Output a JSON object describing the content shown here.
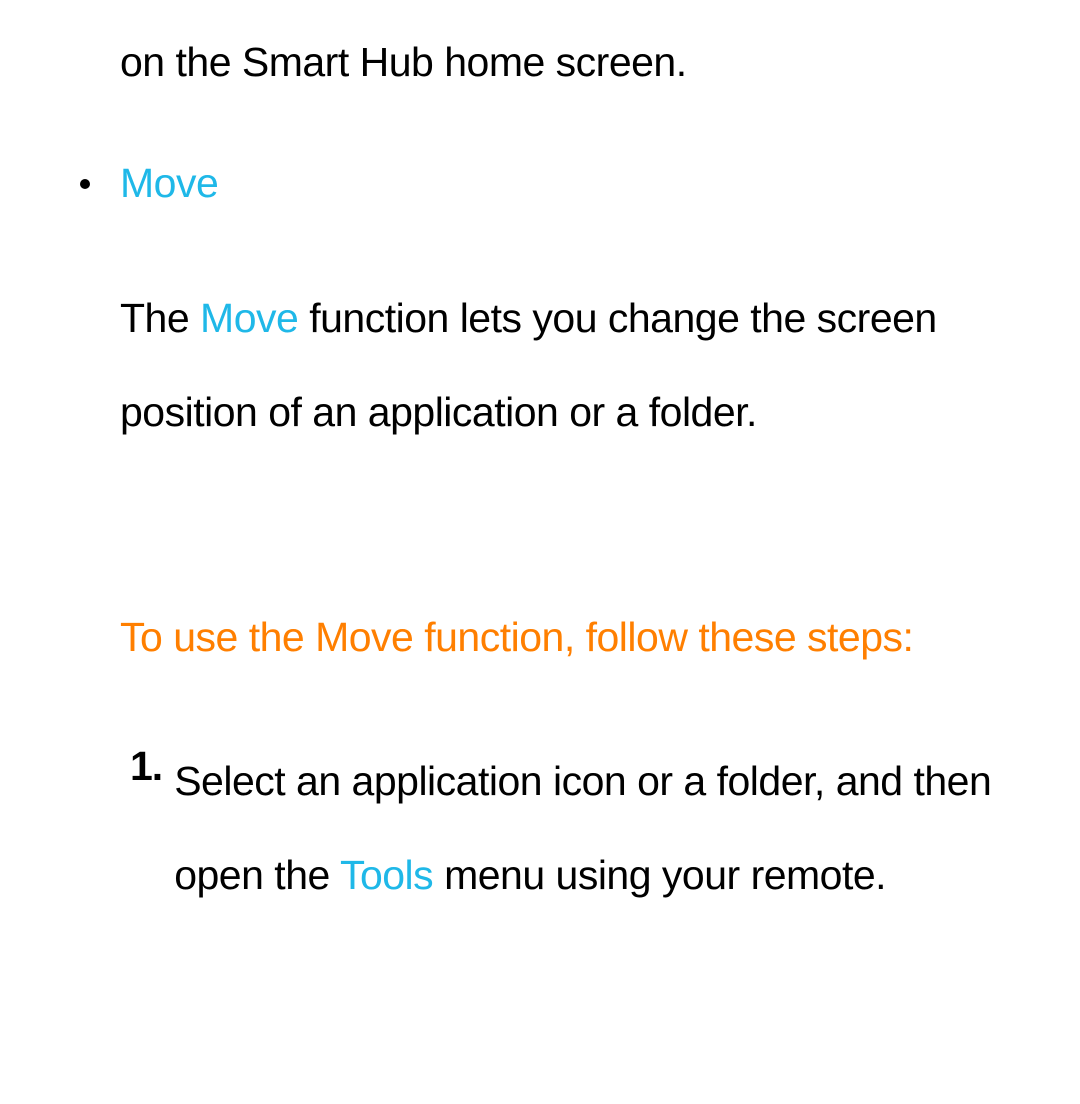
{
  "fragmentTop": "on the Smart Hub home screen.",
  "bullet": {
    "label": "Move"
  },
  "description": {
    "part1": "The ",
    "highlight": "Move",
    "part2": " function lets you change the screen position of an application or a folder."
  },
  "orangeHeading": "To use the Move function, follow these steps:",
  "step1": {
    "number": "1.",
    "part1": "Select an application icon or a folder, and then open the ",
    "highlight": "Tools",
    "part2": " menu using your remote."
  }
}
